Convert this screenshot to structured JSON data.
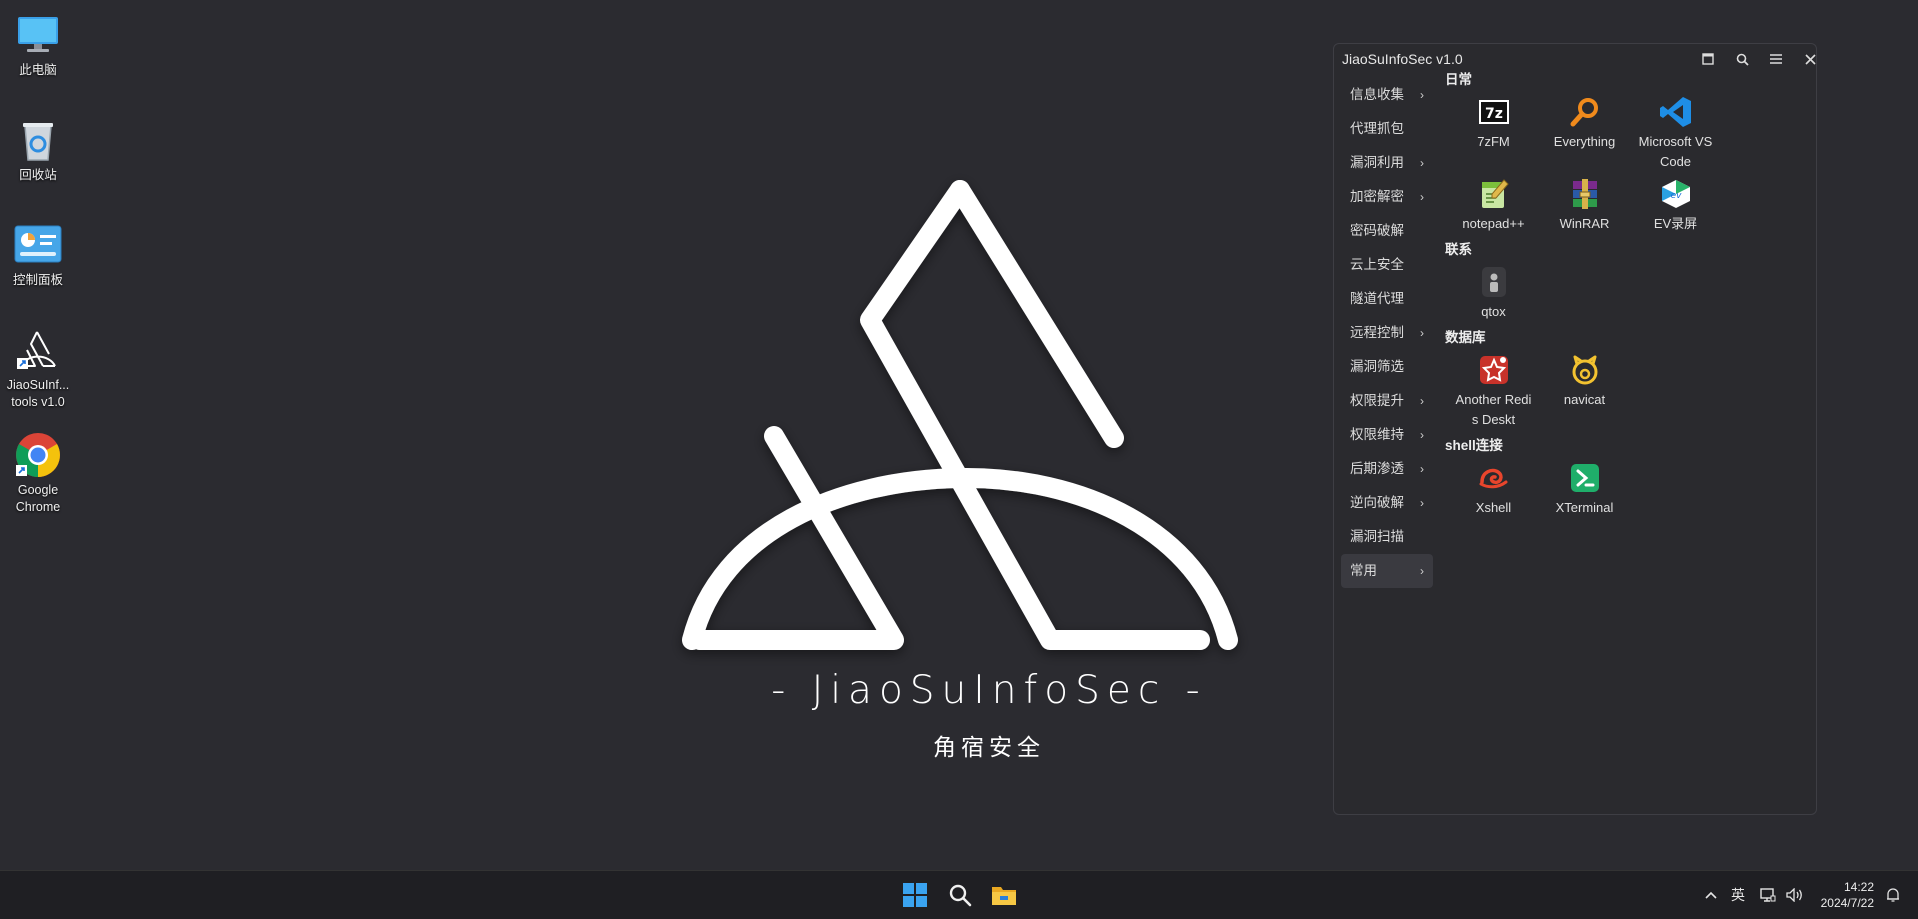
{
  "desktop": {
    "icons": [
      {
        "label": "此电脑"
      },
      {
        "label": "回收站"
      },
      {
        "label": "控制面板"
      },
      {
        "label": "JiaoSuInf... tools v1.0"
      },
      {
        "label": "Google Chrome"
      }
    ]
  },
  "wallpaper": {
    "brand": "-  JiaoSuInfoSec -",
    "subtitle": "角宿安全"
  },
  "window": {
    "title": "JiaoSuInfoSec v1.0",
    "controls": [
      "maximize-icon",
      "search-icon",
      "menu-icon",
      "close-icon"
    ],
    "sidebar": [
      {
        "label": "信息收集",
        "has_submenu": true
      },
      {
        "label": "代理抓包",
        "has_submenu": false
      },
      {
        "label": "漏洞利用",
        "has_submenu": true
      },
      {
        "label": "加密解密",
        "has_submenu": true
      },
      {
        "label": "密码破解",
        "has_submenu": false
      },
      {
        "label": "云上安全",
        "has_submenu": false
      },
      {
        "label": "隧道代理",
        "has_submenu": false
      },
      {
        "label": "远程控制",
        "has_submenu": true
      },
      {
        "label": "漏洞筛选",
        "has_submenu": false
      },
      {
        "label": "权限提升",
        "has_submenu": true
      },
      {
        "label": "权限维持",
        "has_submenu": true
      },
      {
        "label": "后期渗透",
        "has_submenu": true
      },
      {
        "label": "逆向破解",
        "has_submenu": true
      },
      {
        "label": "漏洞扫描",
        "has_submenu": false
      },
      {
        "label": "常用",
        "has_submenu": true,
        "active": true
      }
    ],
    "sections": [
      {
        "title": "日常",
        "apps": [
          {
            "name": "7zFM",
            "icon": "7zip-icon"
          },
          {
            "name": "Everything",
            "icon": "everything-icon"
          },
          {
            "name": "Microsoft VS Code",
            "icon": "vscode-icon"
          },
          {
            "name": "notepad++",
            "icon": "notepadpp-icon"
          },
          {
            "name": "WinRAR",
            "icon": "winrar-icon"
          },
          {
            "name": "EV录屏",
            "icon": "ev-recorder-icon"
          }
        ]
      },
      {
        "title": "联系",
        "apps": [
          {
            "name": "qtox",
            "icon": "qtox-icon"
          }
        ]
      },
      {
        "title": "数据库",
        "apps": [
          {
            "name": "Another Redis Deskt",
            "icon": "redis-icon"
          },
          {
            "name": "navicat",
            "icon": "navicat-icon"
          }
        ]
      },
      {
        "title": "shell连接",
        "apps": [
          {
            "name": "Xshell",
            "icon": "xshell-icon"
          },
          {
            "name": "XTerminal",
            "icon": "xterminal-icon"
          }
        ]
      }
    ]
  },
  "taskbar": {
    "ime": "英",
    "time": "14:22",
    "date": "2024/7/22"
  },
  "colors": {
    "desktop_bg": "#2b2b30",
    "window_bg": "#2a2a2e",
    "taskbar_bg": "#1f1f23",
    "accent": "#0078d4"
  }
}
